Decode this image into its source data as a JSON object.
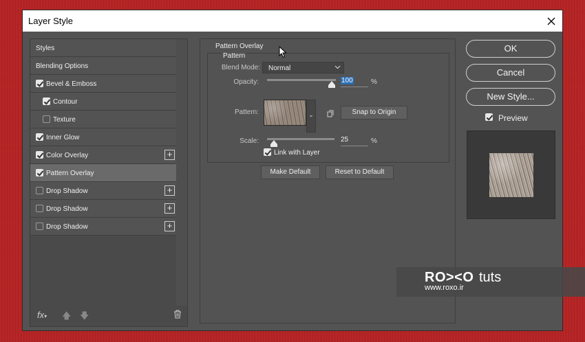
{
  "dialog": {
    "title": "Layer Style"
  },
  "styles_list": {
    "items": [
      {
        "label": "Styles",
        "checkbox": false,
        "checked": false,
        "plus": false,
        "indent": false,
        "selected": false
      },
      {
        "label": "Blending Options",
        "checkbox": false,
        "checked": false,
        "plus": false,
        "indent": false,
        "selected": false
      },
      {
        "label": "Bevel & Emboss",
        "checkbox": true,
        "checked": true,
        "plus": false,
        "indent": false,
        "selected": false
      },
      {
        "label": "Contour",
        "checkbox": true,
        "checked": true,
        "plus": false,
        "indent": true,
        "selected": false
      },
      {
        "label": "Texture",
        "checkbox": true,
        "checked": false,
        "plus": false,
        "indent": true,
        "selected": false
      },
      {
        "label": "Inner Glow",
        "checkbox": true,
        "checked": true,
        "plus": false,
        "indent": false,
        "selected": false
      },
      {
        "label": "Color Overlay",
        "checkbox": true,
        "checked": true,
        "plus": true,
        "indent": false,
        "selected": false
      },
      {
        "label": "Pattern Overlay",
        "checkbox": true,
        "checked": true,
        "plus": false,
        "indent": false,
        "selected": true
      },
      {
        "label": "Drop Shadow",
        "checkbox": true,
        "checked": false,
        "plus": true,
        "indent": false,
        "selected": false
      },
      {
        "label": "Drop Shadow",
        "checkbox": true,
        "checked": false,
        "plus": true,
        "indent": false,
        "selected": false
      },
      {
        "label": "Drop Shadow",
        "checkbox": true,
        "checked": false,
        "plus": true,
        "indent": false,
        "selected": false
      }
    ],
    "footer": {
      "fx_label": "fx"
    }
  },
  "pattern_overlay": {
    "section_title": "Pattern Overlay",
    "group_title": "Pattern",
    "blend_mode_label": "Blend Mode:",
    "blend_mode_value": "Normal",
    "opacity_label": "Opacity:",
    "opacity_value": "100",
    "opacity_fraction": 1.0,
    "pattern_label": "Pattern:",
    "snap_button": "Snap to Origin",
    "scale_label": "Scale:",
    "scale_value": "25",
    "scale_fraction": 0.1,
    "percent": "%",
    "link_label": "Link with Layer",
    "link_checked": true,
    "make_default": "Make Default",
    "reset_default": "Reset to Default"
  },
  "right_buttons": {
    "ok": "OK",
    "cancel": "Cancel",
    "new_style": "New Style..."
  },
  "preview": {
    "label": "Preview",
    "checked": true
  },
  "watermark": {
    "brand": "RO><O",
    "suffix": "tuts",
    "url": "www.roxo.ir"
  }
}
